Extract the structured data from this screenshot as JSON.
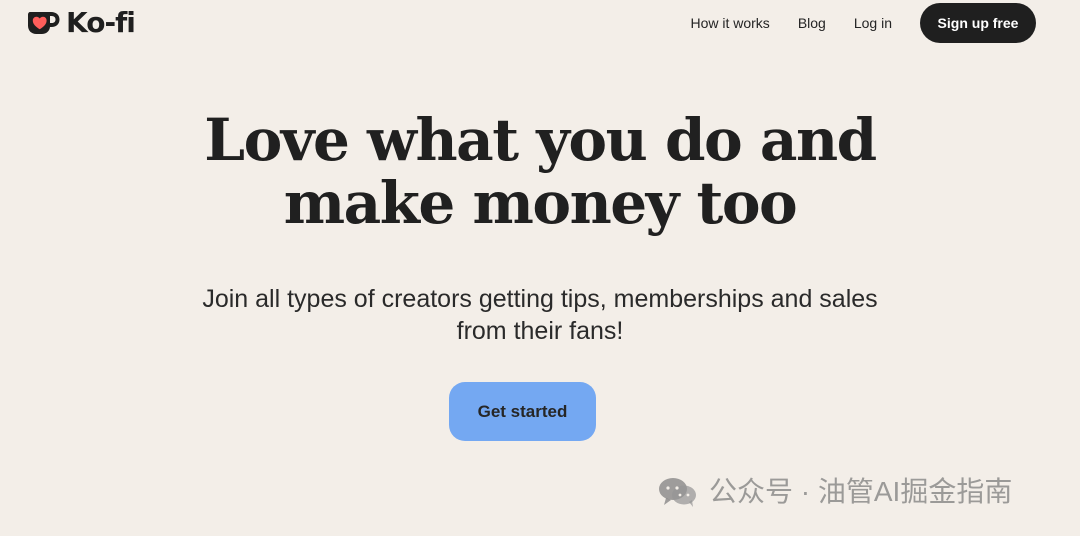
{
  "brand": {
    "name": "Ko-fi",
    "icon": "kofi-cup-heart-icon",
    "colors": {
      "heart": "#ff5e5b",
      "ink": "#1f1f1f"
    }
  },
  "navigation": {
    "items": [
      {
        "label": "How it works"
      },
      {
        "label": "Blog"
      },
      {
        "label": "Log in"
      }
    ],
    "cta_label": "Sign up free"
  },
  "hero": {
    "title_line_1": "Love what you do and",
    "title_line_2": "make money too",
    "subtitle_line_1": "Join all types of creators getting tips, memberships and sales",
    "subtitle_line_2": "from their fans!",
    "button_label": "Get started"
  },
  "watermark": {
    "text": "公众号 · 油管AI掘金指南",
    "icon": "wechat-icon"
  },
  "colors": {
    "page_background": "#f3eee8",
    "primary_button": "#74a8f2",
    "dark_button": "#1f1f1f"
  }
}
